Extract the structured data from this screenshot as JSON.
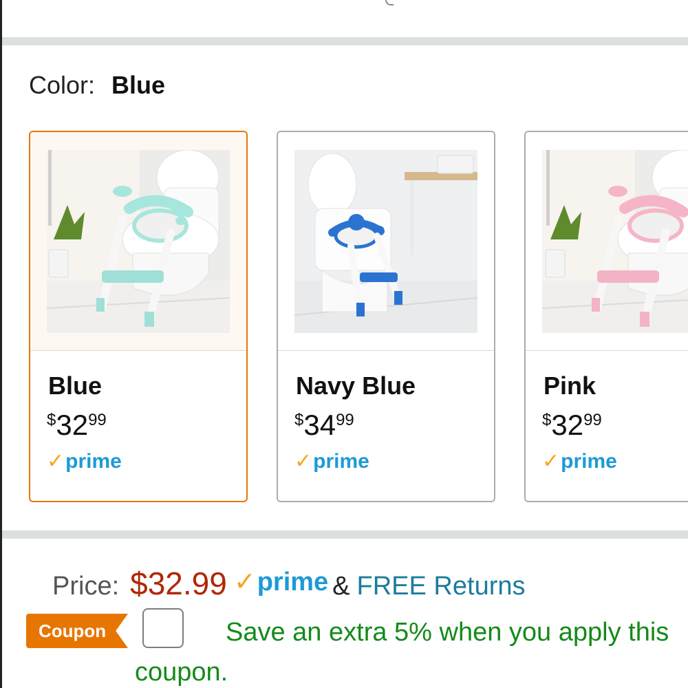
{
  "color_selector": {
    "label": "Color:",
    "selected_value": "Blue"
  },
  "swatches": [
    {
      "name": "Blue",
      "currency": "$",
      "dollars": "32",
      "cents": "99",
      "prime": "prime",
      "selected": true,
      "accent": "#9ee3d8"
    },
    {
      "name": "Navy Blue",
      "currency": "$",
      "dollars": "34",
      "cents": "99",
      "prime": "prime",
      "selected": false,
      "accent": "#2f78d6"
    },
    {
      "name": "Pink",
      "currency": "$",
      "dollars": "32",
      "cents": "99",
      "prime": "prime",
      "selected": false,
      "accent": "#f6b5c6"
    }
  ],
  "price_row": {
    "label": "Price:",
    "value": "$32.99",
    "prime": "prime",
    "ampersand": "&",
    "returns": "FREE Returns"
  },
  "coupon": {
    "badge": "Coupon",
    "text": "Save an extra 5% when you apply this coupon.",
    "checked": false
  },
  "colors": {
    "price_red": "#b12704",
    "prime_blue": "#1e9ad6",
    "prime_check": "#f5a623",
    "coupon_orange": "#e77600",
    "coupon_green": "#148a1a",
    "selected_border": "#e77600"
  }
}
